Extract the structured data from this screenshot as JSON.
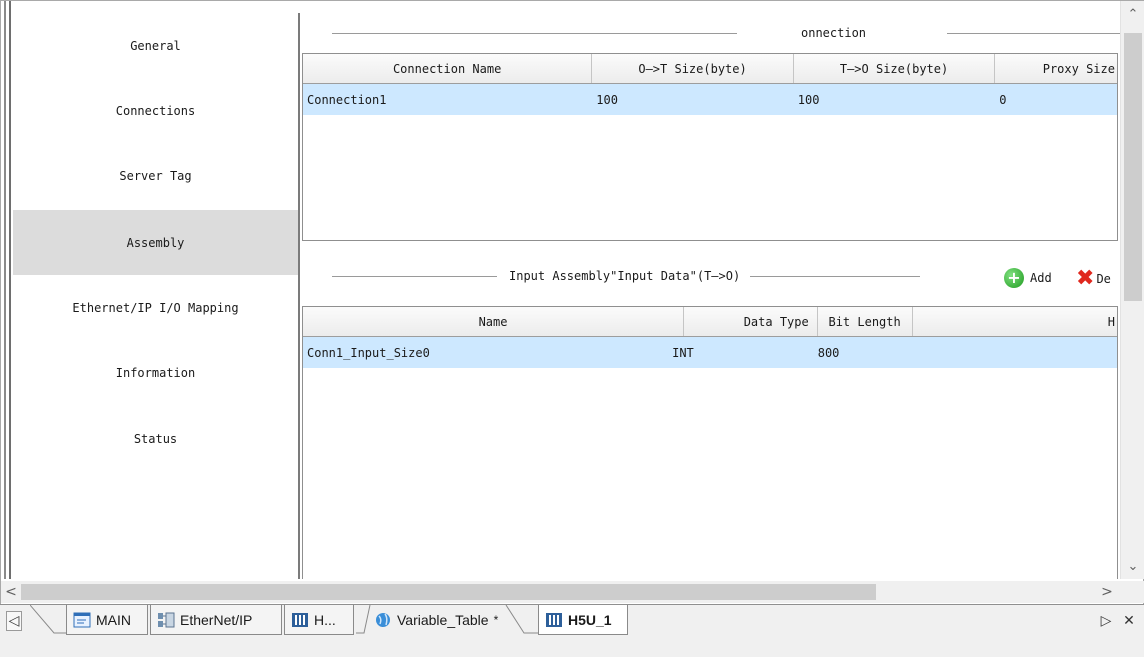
{
  "sidebar": {
    "items": [
      {
        "label": "General"
      },
      {
        "label": "Connections"
      },
      {
        "label": "Server Tag"
      },
      {
        "label": "Assembly"
      },
      {
        "label": "Ethernet/IP I/O Mapping"
      },
      {
        "label": "Information"
      },
      {
        "label": "Status"
      }
    ],
    "active_item": "Assembly"
  },
  "connection_section": {
    "title": "onnection",
    "columns": [
      "Connection Name",
      "O—>T Size(byte)",
      "T—>O Size(byte)",
      "Proxy Size"
    ],
    "rows": [
      [
        "Connection1",
        "100",
        "100",
        "0"
      ]
    ]
  },
  "assembly_section": {
    "title": "Input Assembly\"Input Data\"(T—>O)",
    "add_label": "Add",
    "delete_label": "De",
    "columns": [
      "Name",
      "Data Type",
      "Bit Length",
      "H"
    ],
    "rows": [
      [
        "Conn1_Input_Size0",
        "INT",
        "800",
        ""
      ]
    ]
  },
  "tabs": [
    {
      "label": "MAIN",
      "icon": "program-icon"
    },
    {
      "label": "EtherNet/IP",
      "icon": "network-icon"
    },
    {
      "label": "H...",
      "icon": "module-icon"
    },
    {
      "label": "Variable_Table",
      "icon": "globe-icon",
      "modified": "*"
    },
    {
      "label": "H5U_1",
      "icon": "module-icon"
    }
  ],
  "active_tab": "H5U_1",
  "colors": {
    "selected_row": "#cde8ff",
    "active_sidebar": "#dcdcdc",
    "add_green": "#1f9a1f",
    "delete_red": "#e0281e"
  }
}
